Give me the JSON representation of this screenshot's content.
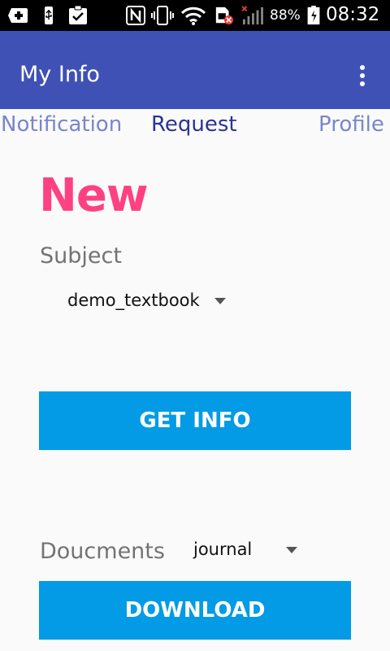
{
  "status_bar": {
    "battery_percent": "88%",
    "clock": "08:32",
    "icons": [
      "add-box-icon",
      "usb-icon",
      "clipboard-check-icon",
      "nfc-icon",
      "vibrate-icon",
      "wifi-icon",
      "sim-error-icon",
      "signal-icon",
      "battery-charging-icon"
    ]
  },
  "toolbar": {
    "title": "My Info",
    "color": "#3f51b5"
  },
  "tabs": [
    {
      "label": "Notification",
      "active": false
    },
    {
      "label": "Request",
      "active": true
    },
    {
      "label": "Profile",
      "active": false
    }
  ],
  "main": {
    "heading": "New",
    "subject_label": "Subject",
    "subject_value": "demo_textbook",
    "get_info_label": "GET INFO",
    "documents_label": "Doucments",
    "documents_value": "journal",
    "download_label": "DOWNLOAD"
  },
  "colors": {
    "accent": "#ff4081",
    "button": "#039be5",
    "tab_active": "#283593",
    "tab_inactive": "#7986cb"
  }
}
